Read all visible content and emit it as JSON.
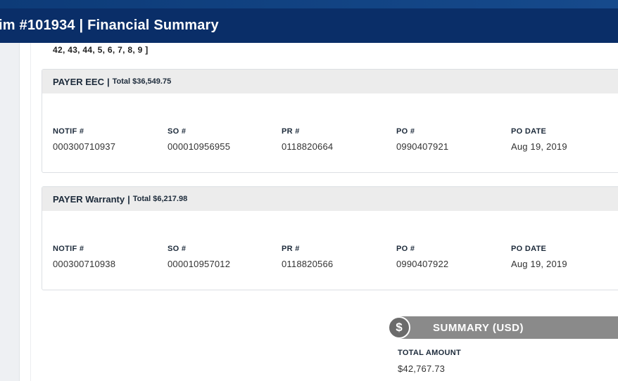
{
  "header": {
    "title": "im #101934 | Financial Summary"
  },
  "list_line": "42, 43, 44, 5, 6, 7, 8, 9 ]",
  "payers": [
    {
      "name": "PAYER EEC",
      "total": "Total $36,549.75",
      "fields": [
        {
          "label": "NOTIF #",
          "value": "000300710937"
        },
        {
          "label": "SO #",
          "value": "000010956955"
        },
        {
          "label": "PR #",
          "value": "0118820664"
        },
        {
          "label": "PO #",
          "value": "0990407921"
        },
        {
          "label": "PO DATE",
          "value": "Aug 19, 2019"
        }
      ]
    },
    {
      "name": "PAYER Warranty",
      "total": "Total $6,217.98",
      "fields": [
        {
          "label": "NOTIF #",
          "value": "000300710938"
        },
        {
          "label": "SO #",
          "value": "000010957012"
        },
        {
          "label": "PR #",
          "value": "0118820566"
        },
        {
          "label": "PO #",
          "value": "0990407922"
        },
        {
          "label": "PO DATE",
          "value": "Aug 19, 2019"
        }
      ]
    }
  ],
  "summary": {
    "icon": "dollar-icon",
    "symbol": "$",
    "title": "SUMMARY (USD)",
    "total_label": "TOTAL AMOUNT",
    "total_value": "$42,767.73"
  },
  "colors": {
    "header_bg": "#0a2e68",
    "summary_bg": "#8a8a8a",
    "card_head_bg": "#ececec"
  }
}
